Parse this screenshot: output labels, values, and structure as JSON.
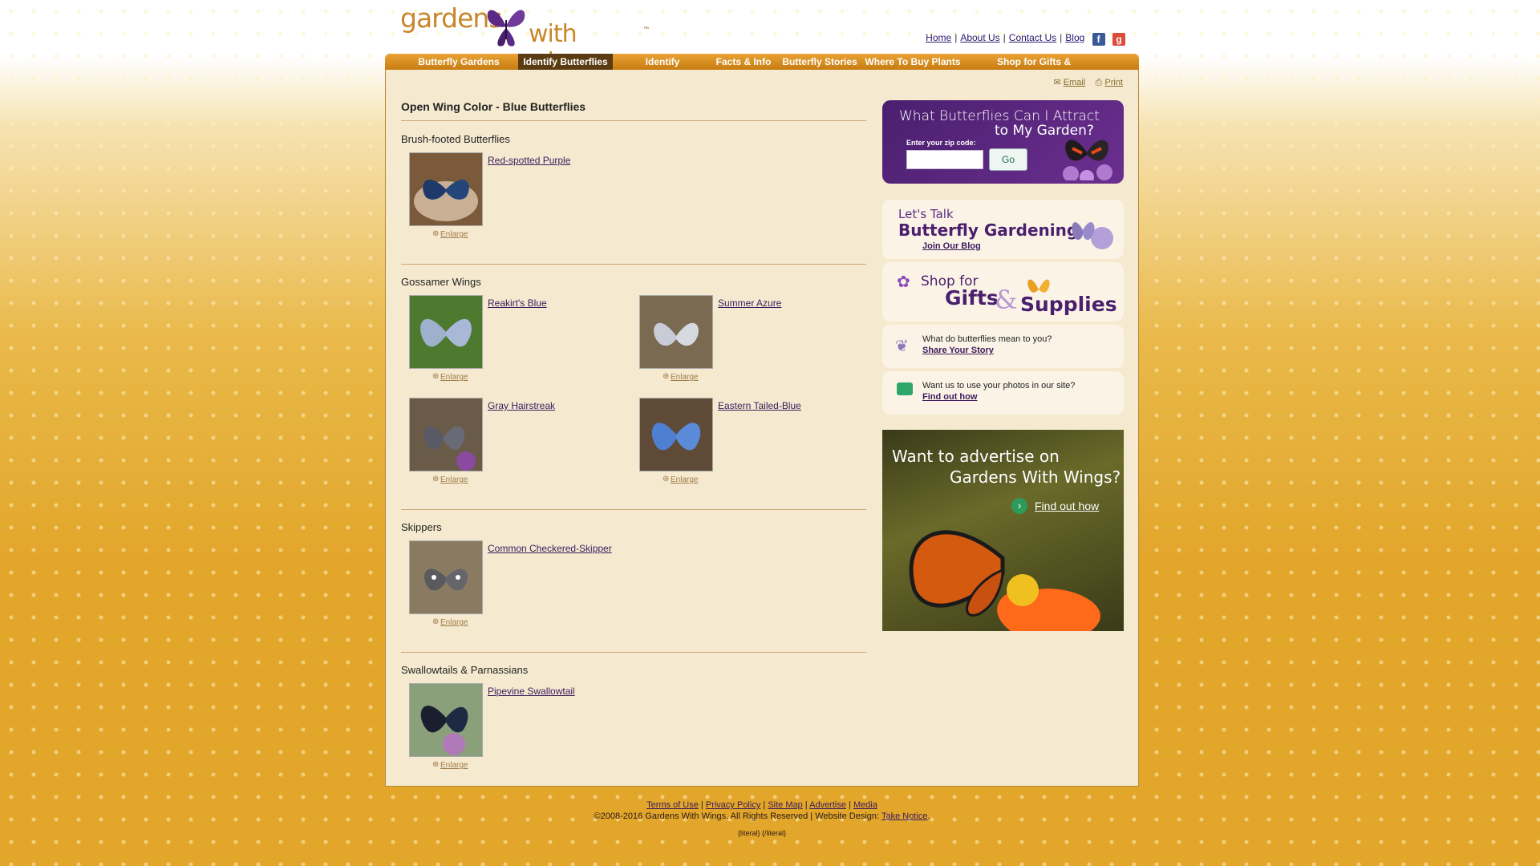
{
  "logo": {
    "part1": "gardens",
    "part2": "with wings",
    "tm": "™"
  },
  "toplinks": [
    "Home",
    "About Us",
    "Contact Us",
    "Blog"
  ],
  "nav": [
    "Butterfly Gardens",
    "Identify Butterflies",
    "Identify Caterpillars",
    "Facts & Info",
    "Butterfly Stories",
    "Where To Buy Plants",
    "Shop for Gifts & Supplies"
  ],
  "tools": {
    "email": "Email",
    "print": "Print"
  },
  "page_title": "Open Wing Color - Blue Butterflies",
  "categories": [
    {
      "name": "Brush-footed Butterflies",
      "items": [
        {
          "name": "Red-spotted Purple"
        }
      ]
    },
    {
      "name": "Gossamer Wings",
      "items": [
        {
          "name": "Reakirt's Blue"
        },
        {
          "name": "Summer Azure"
        },
        {
          "name": "Gray Hairstreak"
        },
        {
          "name": "Eastern Tailed-Blue"
        }
      ]
    },
    {
      "name": "Skippers",
      "items": [
        {
          "name": "Common Checkered-Skipper"
        }
      ]
    },
    {
      "name": "Swallowtails & Parnassians",
      "items": [
        {
          "name": "Pipevine Swallowtail"
        }
      ]
    }
  ],
  "enlarge_label": "Enlarge",
  "zipbox": {
    "title1": "What Butterflies Can I Attract",
    "title2": "to My Garden?",
    "label": "Enter your zip code:",
    "button": "Go"
  },
  "blog_box": {
    "l1": "Let's Talk",
    "l2": "Butterfly Gardening",
    "link": "Join Our Blog"
  },
  "shop_box": {
    "l1": "Shop for",
    "l2": "Gifts",
    "amp": "&",
    "l3": "Supplies"
  },
  "story_box": {
    "text": "What do butterflies mean to you?",
    "link": "Share Your Story"
  },
  "photo_box": {
    "text": "Want us to use your photos in our site?",
    "link": "Find out how"
  },
  "ad_box": {
    "l1": "Want to advertise on",
    "l2": "Gardens With Wings?",
    "link": "Find out how"
  },
  "footer": {
    "links": [
      "Terms of Use",
      "Privacy Policy",
      "Site Map",
      "Advertise",
      "Media"
    ],
    "copyright": "©2008-2016 Gardens With Wings. All Rights Reserved | Website Design:",
    "design_link": "Take Notice",
    "literal": "{literal} {/literal}"
  }
}
